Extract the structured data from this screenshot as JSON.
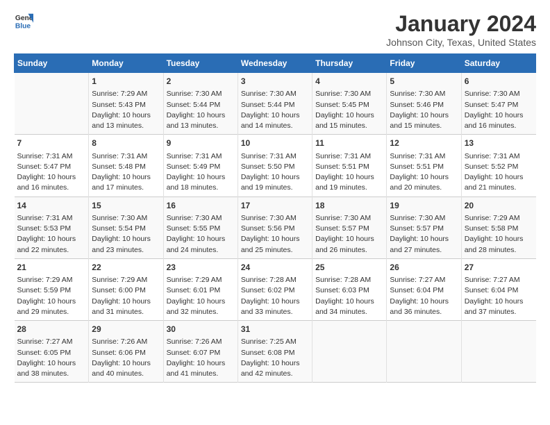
{
  "header": {
    "logo_general": "General",
    "logo_blue": "Blue",
    "title": "January 2024",
    "subtitle": "Johnson City, Texas, United States"
  },
  "days_of_week": [
    "Sunday",
    "Monday",
    "Tuesday",
    "Wednesday",
    "Thursday",
    "Friday",
    "Saturday"
  ],
  "weeks": [
    [
      {
        "day": "",
        "detail": ""
      },
      {
        "day": "1",
        "detail": "Sunrise: 7:29 AM\nSunset: 5:43 PM\nDaylight: 10 hours\nand 13 minutes."
      },
      {
        "day": "2",
        "detail": "Sunrise: 7:30 AM\nSunset: 5:44 PM\nDaylight: 10 hours\nand 13 minutes."
      },
      {
        "day": "3",
        "detail": "Sunrise: 7:30 AM\nSunset: 5:44 PM\nDaylight: 10 hours\nand 14 minutes."
      },
      {
        "day": "4",
        "detail": "Sunrise: 7:30 AM\nSunset: 5:45 PM\nDaylight: 10 hours\nand 15 minutes."
      },
      {
        "day": "5",
        "detail": "Sunrise: 7:30 AM\nSunset: 5:46 PM\nDaylight: 10 hours\nand 15 minutes."
      },
      {
        "day": "6",
        "detail": "Sunrise: 7:30 AM\nSunset: 5:47 PM\nDaylight: 10 hours\nand 16 minutes."
      }
    ],
    [
      {
        "day": "7",
        "detail": "Sunrise: 7:31 AM\nSunset: 5:47 PM\nDaylight: 10 hours\nand 16 minutes."
      },
      {
        "day": "8",
        "detail": "Sunrise: 7:31 AM\nSunset: 5:48 PM\nDaylight: 10 hours\nand 17 minutes."
      },
      {
        "day": "9",
        "detail": "Sunrise: 7:31 AM\nSunset: 5:49 PM\nDaylight: 10 hours\nand 18 minutes."
      },
      {
        "day": "10",
        "detail": "Sunrise: 7:31 AM\nSunset: 5:50 PM\nDaylight: 10 hours\nand 19 minutes."
      },
      {
        "day": "11",
        "detail": "Sunrise: 7:31 AM\nSunset: 5:51 PM\nDaylight: 10 hours\nand 19 minutes."
      },
      {
        "day": "12",
        "detail": "Sunrise: 7:31 AM\nSunset: 5:51 PM\nDaylight: 10 hours\nand 20 minutes."
      },
      {
        "day": "13",
        "detail": "Sunrise: 7:31 AM\nSunset: 5:52 PM\nDaylight: 10 hours\nand 21 minutes."
      }
    ],
    [
      {
        "day": "14",
        "detail": "Sunrise: 7:31 AM\nSunset: 5:53 PM\nDaylight: 10 hours\nand 22 minutes."
      },
      {
        "day": "15",
        "detail": "Sunrise: 7:30 AM\nSunset: 5:54 PM\nDaylight: 10 hours\nand 23 minutes."
      },
      {
        "day": "16",
        "detail": "Sunrise: 7:30 AM\nSunset: 5:55 PM\nDaylight: 10 hours\nand 24 minutes."
      },
      {
        "day": "17",
        "detail": "Sunrise: 7:30 AM\nSunset: 5:56 PM\nDaylight: 10 hours\nand 25 minutes."
      },
      {
        "day": "18",
        "detail": "Sunrise: 7:30 AM\nSunset: 5:57 PM\nDaylight: 10 hours\nand 26 minutes."
      },
      {
        "day": "19",
        "detail": "Sunrise: 7:30 AM\nSunset: 5:57 PM\nDaylight: 10 hours\nand 27 minutes."
      },
      {
        "day": "20",
        "detail": "Sunrise: 7:29 AM\nSunset: 5:58 PM\nDaylight: 10 hours\nand 28 minutes."
      }
    ],
    [
      {
        "day": "21",
        "detail": "Sunrise: 7:29 AM\nSunset: 5:59 PM\nDaylight: 10 hours\nand 29 minutes."
      },
      {
        "day": "22",
        "detail": "Sunrise: 7:29 AM\nSunset: 6:00 PM\nDaylight: 10 hours\nand 31 minutes."
      },
      {
        "day": "23",
        "detail": "Sunrise: 7:29 AM\nSunset: 6:01 PM\nDaylight: 10 hours\nand 32 minutes."
      },
      {
        "day": "24",
        "detail": "Sunrise: 7:28 AM\nSunset: 6:02 PM\nDaylight: 10 hours\nand 33 minutes."
      },
      {
        "day": "25",
        "detail": "Sunrise: 7:28 AM\nSunset: 6:03 PM\nDaylight: 10 hours\nand 34 minutes."
      },
      {
        "day": "26",
        "detail": "Sunrise: 7:27 AM\nSunset: 6:04 PM\nDaylight: 10 hours\nand 36 minutes."
      },
      {
        "day": "27",
        "detail": "Sunrise: 7:27 AM\nSunset: 6:04 PM\nDaylight: 10 hours\nand 37 minutes."
      }
    ],
    [
      {
        "day": "28",
        "detail": "Sunrise: 7:27 AM\nSunset: 6:05 PM\nDaylight: 10 hours\nand 38 minutes."
      },
      {
        "day": "29",
        "detail": "Sunrise: 7:26 AM\nSunset: 6:06 PM\nDaylight: 10 hours\nand 40 minutes."
      },
      {
        "day": "30",
        "detail": "Sunrise: 7:26 AM\nSunset: 6:07 PM\nDaylight: 10 hours\nand 41 minutes."
      },
      {
        "day": "31",
        "detail": "Sunrise: 7:25 AM\nSunset: 6:08 PM\nDaylight: 10 hours\nand 42 minutes."
      },
      {
        "day": "",
        "detail": ""
      },
      {
        "day": "",
        "detail": ""
      },
      {
        "day": "",
        "detail": ""
      }
    ]
  ]
}
